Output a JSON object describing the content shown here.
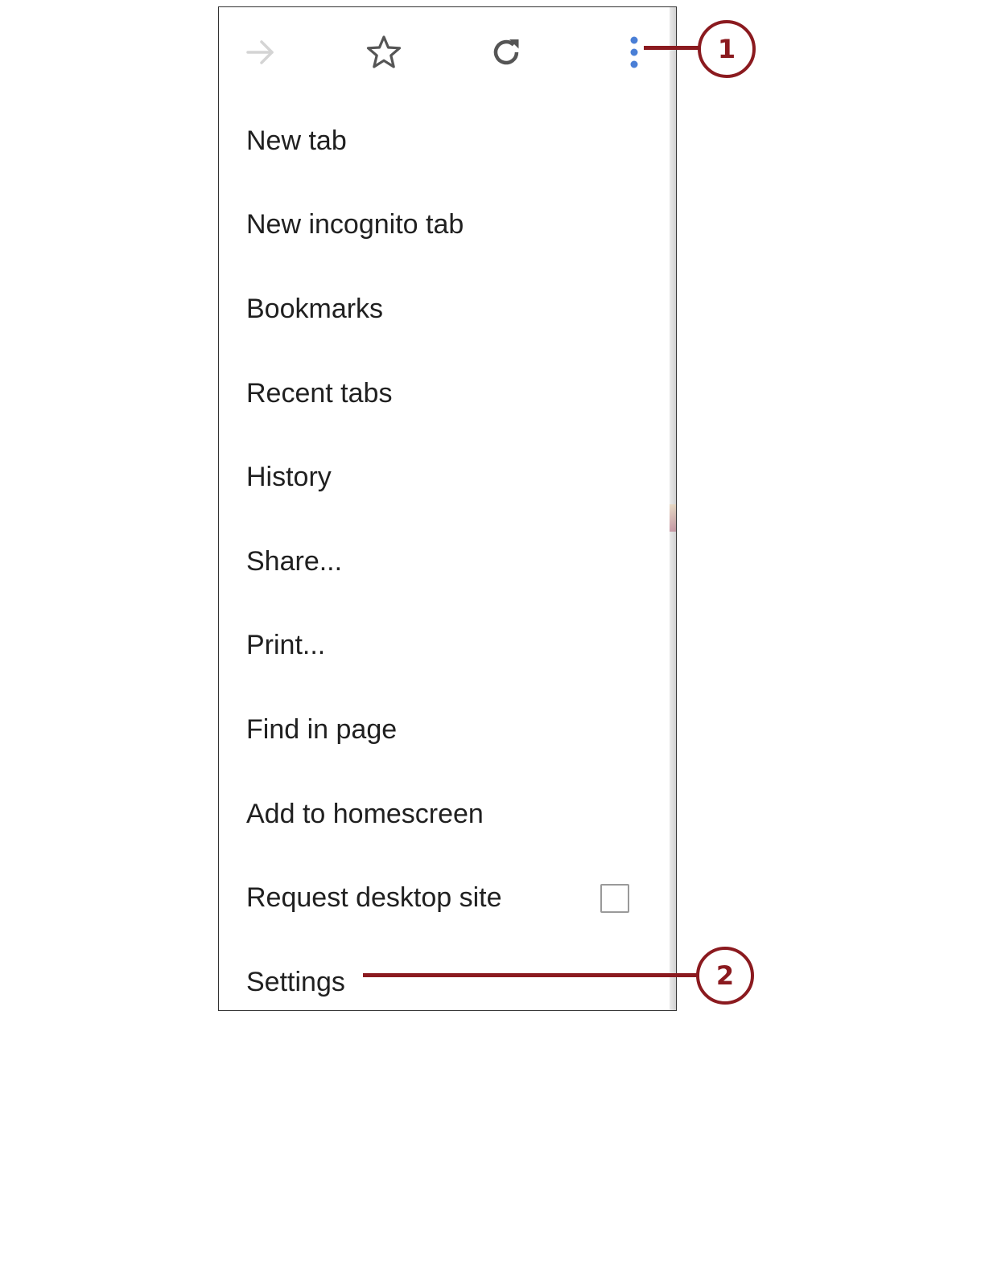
{
  "toolbar": {
    "icons": [
      "forward-arrow-icon",
      "bookmark-star-icon",
      "reload-icon",
      "more-options-icon"
    ],
    "colors": {
      "forward_disabled": "#cfcfcf",
      "icon_default": "#5f6368",
      "menu_dots": "#4a7fd6"
    }
  },
  "menu": {
    "items": [
      {
        "label": "New tab"
      },
      {
        "label": "New incognito tab"
      },
      {
        "label": "Bookmarks"
      },
      {
        "label": "Recent tabs"
      },
      {
        "label": "History"
      },
      {
        "label": "Share..."
      },
      {
        "label": "Print..."
      },
      {
        "label": "Find in page"
      },
      {
        "label": "Add to homescreen"
      },
      {
        "label": "Request desktop site",
        "checkbox": false
      },
      {
        "label": "Settings"
      }
    ]
  },
  "callouts": [
    {
      "number": "1"
    },
    {
      "number": "2"
    }
  ],
  "colors": {
    "callout": "#8b1a1f",
    "text": "#202020"
  }
}
